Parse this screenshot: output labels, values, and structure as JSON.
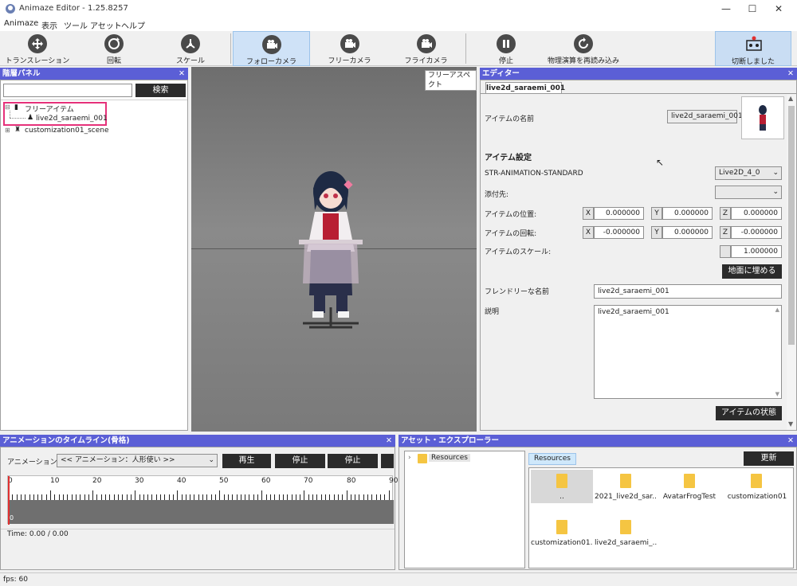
{
  "window": {
    "title": "Animaze Editor - 1.25.8257"
  },
  "menu": [
    "Animaze",
    "表示",
    "ツール",
    "アセット",
    "ヘルプ"
  ],
  "toolbar": {
    "translate": "トランスレーション",
    "rotate": "回転",
    "scale": "スケール",
    "follow_camera": "フォローカメラ",
    "free_camera": "フリーカメラ",
    "fly_camera": "フライカメラ",
    "stop": "停止",
    "reload_physics": "物理演算を再読み込み",
    "disconnected": "切断しました"
  },
  "hierarchy": {
    "title": "階層パネル",
    "search_button": "検索",
    "search_value": "",
    "items": [
      "フリーアイテム",
      "live2d_saraemi_001",
      "customization01_scene"
    ]
  },
  "viewport": {
    "aspect_label": "フリーアスペクト"
  },
  "editor": {
    "title": "エディター",
    "tab": "live2d_saraemi_001",
    "item_name_label": "アイテムの名前",
    "item_name_value": "live2d_saraemi_001",
    "item_settings": "アイテム設定",
    "anim_standard_label": "STR-ANIMATION-STANDARD",
    "anim_standard_value": "Live2D_4_0",
    "attach_label": "添付先:",
    "attach_value": "",
    "position_label": "アイテムの位置:",
    "position": [
      "0.000000",
      "0.000000",
      "0.000000"
    ],
    "rotation_label": "アイテムの回転:",
    "rotation": [
      "-0.000000",
      "0.000000",
      "-0.000000"
    ],
    "scale_label": "アイテムのスケール:",
    "scale_value": "1.000000",
    "bury_button": "地面に埋める",
    "friendly_name_label": "フレンドリーな名前",
    "friendly_name_value": "live2d_saraemi_001",
    "description_label": "説明",
    "description_value": "live2d_saraemi_001",
    "item_state_button": "アイテムの状態",
    "axes": [
      "X",
      "Y",
      "Z"
    ]
  },
  "timeline": {
    "title": "アニメーションのタイムライン(骨格)",
    "anim_label": "アニメーション：",
    "anim_select": "<< アニメーション：人形使い >>",
    "play": "再生",
    "stop1": "停止",
    "stop2": "停止",
    "ruler": [
      "0",
      "10",
      "20",
      "30",
      "40",
      "50",
      "60",
      "70",
      "80",
      "90"
    ],
    "time": "Time: 0.00 / 0.00",
    "track_label": "0"
  },
  "assets": {
    "title": "アセット・エクスプローラー",
    "tree_root": "Resources",
    "path_chip": "Resources",
    "refresh": "更新",
    "files": [
      "..",
      "2021_live2d_sar...",
      "AvatarFrogTest",
      "customization01",
      "customization01...",
      "live2d_saraemi_..."
    ]
  },
  "status": {
    "fps": "fps: 60"
  },
  "colors": {
    "panel_header": "#5b5fd6",
    "highlight": "#e6317a",
    "active_tool": "#cfe2f7"
  }
}
